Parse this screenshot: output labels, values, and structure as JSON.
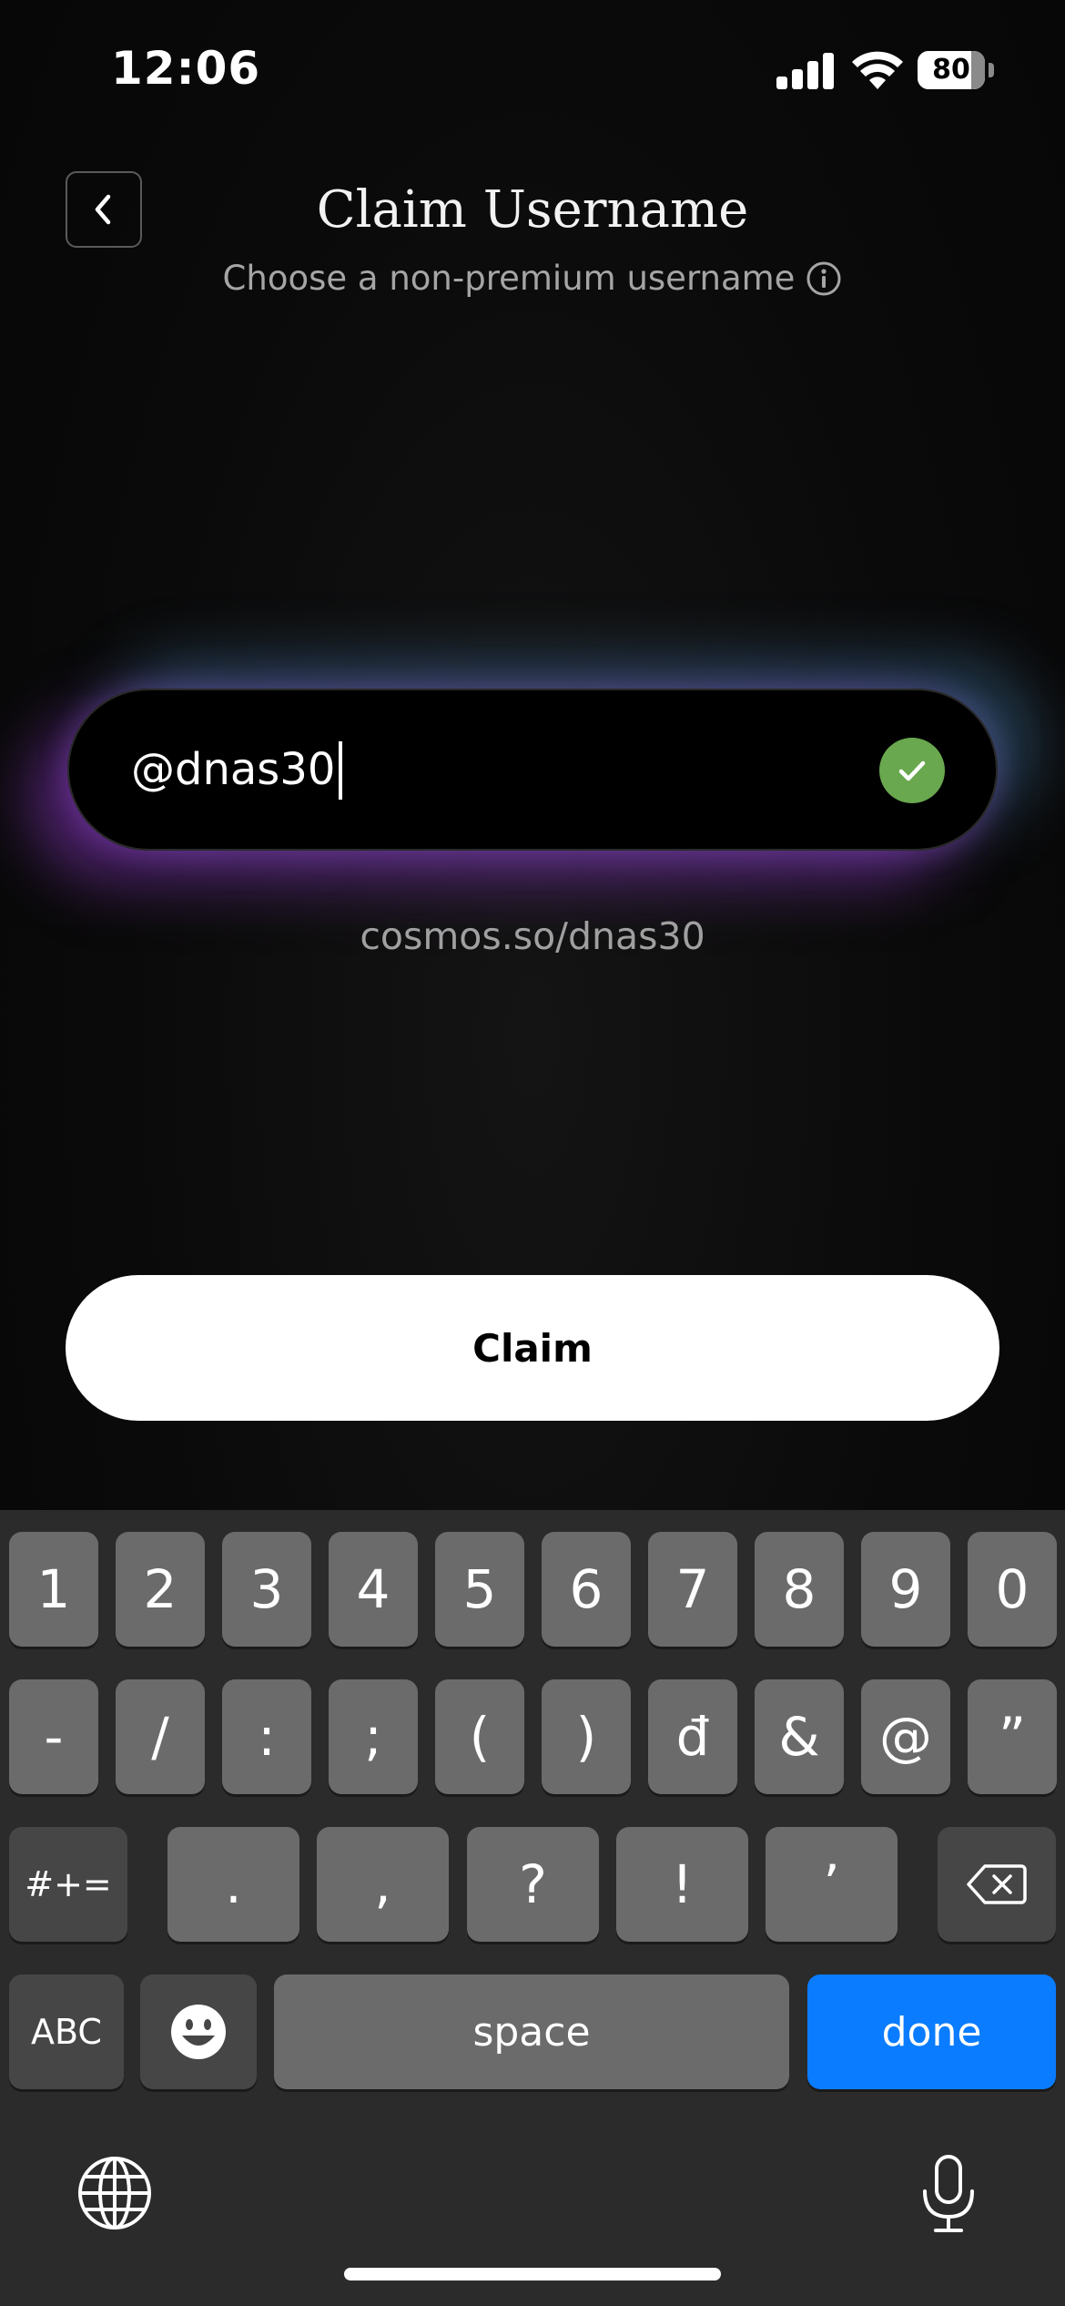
{
  "status_bar": {
    "time": "12:06",
    "battery": "80"
  },
  "header": {
    "title": "Claim Username",
    "subtitle": "Choose a non-premium username"
  },
  "username": {
    "value": "@dnas30",
    "profile_url": "cosmos.so/dnas30",
    "valid_color": "#6aa84f"
  },
  "claim_button": {
    "label": "Claim"
  },
  "keyboard": {
    "row1": [
      "1",
      "2",
      "3",
      "4",
      "5",
      "6",
      "7",
      "8",
      "9",
      "0"
    ],
    "row2": [
      "-",
      "/",
      ":",
      ";",
      "(",
      ")",
      "đ",
      "&",
      "@",
      "”"
    ],
    "row3_shift": "#+=",
    "row3": [
      ".",
      ",",
      "?",
      "!",
      "’"
    ],
    "abc": "ABC",
    "space": "space",
    "done": "done",
    "done_color": "#0a7cff"
  }
}
